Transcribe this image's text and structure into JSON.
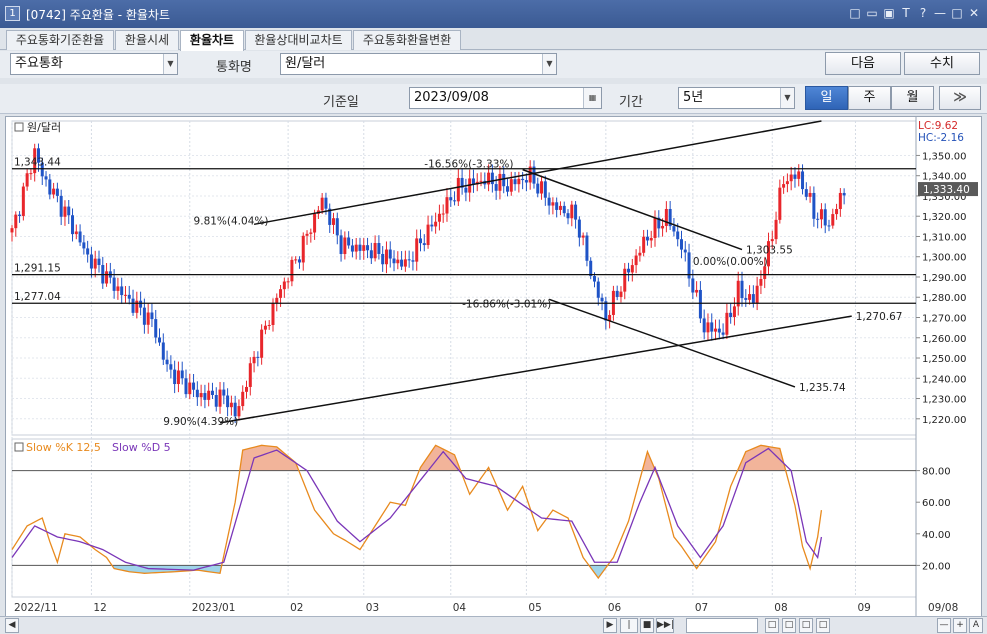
{
  "titlebar": {
    "number": "1",
    "title": "[0742] 주요환율 - 환율차트",
    "icons": [
      "□",
      "▭",
      "▣",
      "T",
      "?",
      "—",
      "□",
      "✕"
    ]
  },
  "tabs": [
    "주요통화기준환율",
    "환율시세",
    "환율차트",
    "환율상대비교차트",
    "주요통화환율변환"
  ],
  "active_tab": 2,
  "controls": {
    "currency_group": "주요통화",
    "currency_label": "통화명",
    "currency_value": "원/달러",
    "next_button": "다음",
    "value_button": "수치",
    "base_date_label": "기준일",
    "base_date": "2023/09/08",
    "period_label": "기간",
    "period_value": "5년",
    "period_units": [
      "일",
      "주",
      "월"
    ],
    "active_unit": 0,
    "more_button": "≫"
  },
  "chart_data": [
    {
      "type": "candlestick",
      "title": "원/달러",
      "lc_label": "LC:9.62",
      "hc_label": "HC:-2.16",
      "current_value": "1,333.40",
      "current_value_num": 1333.4,
      "ylim": [
        1212,
        1367
      ],
      "yticks": [
        "1,350.00",
        "1,340.00",
        "1,330.00",
        "1,320.00",
        "1,310.00",
        "1,300.00",
        "1,290.00",
        "1,280.00",
        "1,270.00",
        "1,260.00",
        "1,250.00",
        "1,240.00",
        "1,230.00",
        "1,220.00"
      ],
      "ytick_values": [
        1350,
        1340,
        1330,
        1320,
        1310,
        1300,
        1290,
        1280,
        1270,
        1260,
        1250,
        1240,
        1230,
        1220
      ],
      "x_months": [
        "2022/11",
        "12",
        "2023/01",
        "02",
        "03",
        "04",
        "05",
        "06",
        "07",
        "08",
        "09"
      ],
      "x_month_day_index": [
        0,
        21,
        47,
        73,
        93,
        116,
        136,
        157,
        180,
        201,
        223
      ],
      "x_last_date": "09/08",
      "x_day_range": [
        0,
        239
      ],
      "horizontal_lines": [
        {
          "value": 1343.44,
          "label": "1,343.44"
        },
        {
          "value": 1291.15,
          "label": "1,291.15"
        },
        {
          "value": 1277.04,
          "label": "1,277.04"
        }
      ],
      "trend_lines": [
        {
          "from": [
            64,
            1316
          ],
          "to": [
            214,
            1367
          ],
          "label": ""
        },
        {
          "from": [
            55,
            1218
          ],
          "to": [
            222,
            1270.67
          ],
          "label": "1,270.67"
        },
        {
          "from": [
            135,
            1343
          ],
          "to": [
            193,
            1303.55
          ],
          "label": "1,303.55"
        },
        {
          "from": [
            142,
            1279
          ],
          "to": [
            207,
            1235.74
          ],
          "label": "1,235.74"
        }
      ],
      "annotations": [
        {
          "text": "9.81%(4.04%)",
          "day": 48,
          "value": 1316
        },
        {
          "text": "-16.56%(-3.33%)",
          "day": 109,
          "value": 1344
        },
        {
          "text": "9.90%(4.39%)",
          "day": 40,
          "value": 1217
        },
        {
          "text": "0.00%(0.00%)",
          "day": 180,
          "value": 1296
        },
        {
          "text": "-16.86%(-3.01%)",
          "day": 119,
          "value": 1275
        }
      ],
      "candle_anchors": [
        [
          0,
          1312
        ],
        [
          6,
          1352
        ],
        [
          8,
          1340
        ],
        [
          14,
          1322
        ],
        [
          20,
          1300
        ],
        [
          30,
          1280
        ],
        [
          37,
          1268
        ],
        [
          41,
          1245
        ],
        [
          49,
          1232
        ],
        [
          57,
          1230
        ],
        [
          59,
          1221
        ],
        [
          64,
          1250
        ],
        [
          70,
          1280
        ],
        [
          76,
          1302
        ],
        [
          82,
          1328
        ],
        [
          87,
          1306
        ],
        [
          95,
          1303
        ],
        [
          104,
          1296
        ],
        [
          112,
          1318
        ],
        [
          118,
          1334
        ],
        [
          125,
          1338
        ],
        [
          131,
          1335
        ],
        [
          137,
          1340
        ],
        [
          143,
          1325
        ],
        [
          149,
          1320
        ],
        [
          153,
          1292
        ],
        [
          157,
          1270
        ],
        [
          162,
          1290
        ],
        [
          168,
          1310
        ],
        [
          173,
          1320
        ],
        [
          177,
          1305
        ],
        [
          183,
          1265
        ],
        [
          188,
          1263
        ],
        [
          192,
          1283
        ],
        [
          196,
          1278
        ],
        [
          200,
          1303
        ],
        [
          204,
          1338
        ],
        [
          208,
          1340
        ],
        [
          212,
          1322
        ],
        [
          216,
          1316
        ],
        [
          220,
          1333
        ]
      ],
      "colors": {
        "up": "#e8262b",
        "down": "#1f53c6"
      }
    },
    {
      "type": "line",
      "title": "Slow %K 12,5  Slow %D 5",
      "series_k_name": "Slow %K 12,5",
      "series_d_name": "Slow %D 5",
      "ylim": [
        0,
        100
      ],
      "yticks": [
        "80.00",
        "60.00",
        "40.00",
        "20.00"
      ],
      "ytick_values": [
        80,
        60,
        40,
        20
      ],
      "overbought": 80,
      "oversold": 20,
      "k_anchors": [
        [
          0,
          30
        ],
        [
          4,
          45
        ],
        [
          8,
          50
        ],
        [
          10,
          35
        ],
        [
          12,
          22
        ],
        [
          14,
          40
        ],
        [
          18,
          38
        ],
        [
          22,
          30
        ],
        [
          25,
          25
        ],
        [
          27,
          18
        ],
        [
          31,
          16
        ],
        [
          35,
          15
        ],
        [
          43,
          16
        ],
        [
          49,
          17
        ],
        [
          55,
          15
        ],
        [
          59,
          60
        ],
        [
          61,
          93
        ],
        [
          66,
          96
        ],
        [
          70,
          95
        ],
        [
          75,
          85
        ],
        [
          80,
          55
        ],
        [
          85,
          40
        ],
        [
          88,
          36
        ],
        [
          92,
          30
        ],
        [
          96,
          45
        ],
        [
          100,
          60
        ],
        [
          104,
          58
        ],
        [
          108,
          82
        ],
        [
          112,
          96
        ],
        [
          117,
          90
        ],
        [
          121,
          65
        ],
        [
          126,
          82
        ],
        [
          131,
          55
        ],
        [
          135,
          70
        ],
        [
          139,
          42
        ],
        [
          143,
          55
        ],
        [
          147,
          50
        ],
        [
          151,
          25
        ],
        [
          155,
          12
        ],
        [
          159,
          25
        ],
        [
          163,
          48
        ],
        [
          168,
          92
        ],
        [
          171,
          75
        ],
        [
          175,
          38
        ],
        [
          177,
          32
        ],
        [
          181,
          18
        ],
        [
          186,
          35
        ],
        [
          190,
          70
        ],
        [
          194,
          92
        ],
        [
          198,
          96
        ],
        [
          203,
          94
        ],
        [
          207,
          58
        ],
        [
          209,
          32
        ],
        [
          211,
          18
        ],
        [
          213,
          38
        ],
        [
          214,
          55
        ]
      ],
      "d_anchors": [
        [
          0,
          25
        ],
        [
          6,
          45
        ],
        [
          12,
          38
        ],
        [
          18,
          35
        ],
        [
          24,
          30
        ],
        [
          30,
          22
        ],
        [
          36,
          18
        ],
        [
          48,
          17
        ],
        [
          56,
          22
        ],
        [
          60,
          55
        ],
        [
          64,
          88
        ],
        [
          70,
          93
        ],
        [
          78,
          80
        ],
        [
          86,
          48
        ],
        [
          92,
          35
        ],
        [
          100,
          50
        ],
        [
          108,
          74
        ],
        [
          114,
          92
        ],
        [
          120,
          75
        ],
        [
          128,
          70
        ],
        [
          134,
          60
        ],
        [
          140,
          50
        ],
        [
          148,
          48
        ],
        [
          154,
          22
        ],
        [
          160,
          22
        ],
        [
          166,
          60
        ],
        [
          170,
          82
        ],
        [
          176,
          45
        ],
        [
          182,
          25
        ],
        [
          188,
          45
        ],
        [
          194,
          85
        ],
        [
          200,
          94
        ],
        [
          206,
          80
        ],
        [
          210,
          35
        ],
        [
          213,
          25
        ],
        [
          214,
          38
        ]
      ],
      "colors": {
        "k": "#e88a1e",
        "d": "#7a36b8",
        "fill_over": "#f2b49a",
        "fill_under": "#9fd4ea"
      }
    }
  ],
  "bottombar": {
    "buttons": [
      "◀",
      "▶",
      "|◀◀",
      "■",
      "▶▶|",
      "□",
      "□",
      "□",
      "□",
      "—",
      "+",
      "A"
    ]
  }
}
